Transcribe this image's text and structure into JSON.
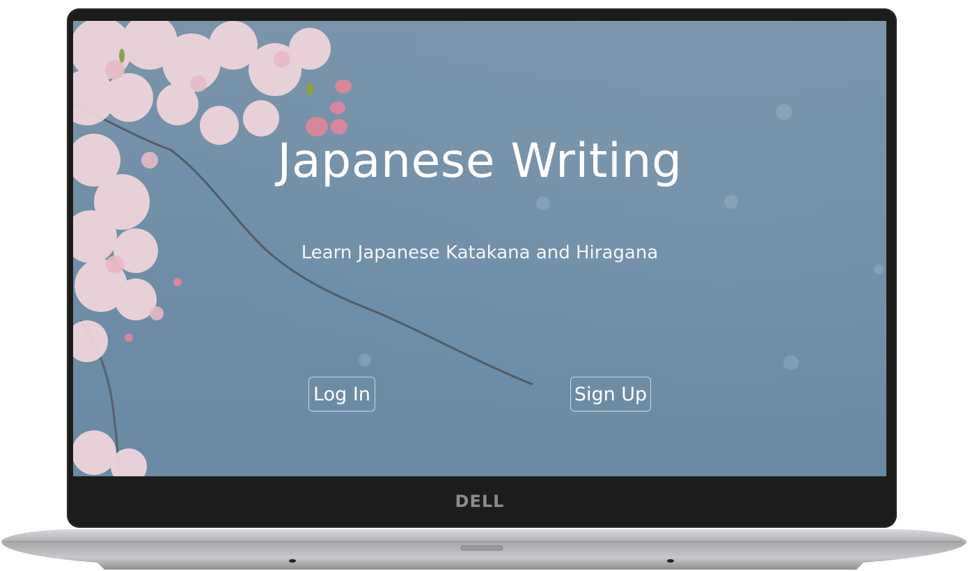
{
  "device": {
    "brand_logo": "DELL",
    "bezel_color": "#1c1c1a",
    "body_color": "#b9babc"
  },
  "hero": {
    "title": "Japanese Writing",
    "subtitle": "Learn Japanese Katakana and Hiragana",
    "background": "cherry-blossom-photo",
    "sky_color": "#7190a8"
  },
  "actions": {
    "login_label": "Log In",
    "signup_label": "Sign Up"
  }
}
